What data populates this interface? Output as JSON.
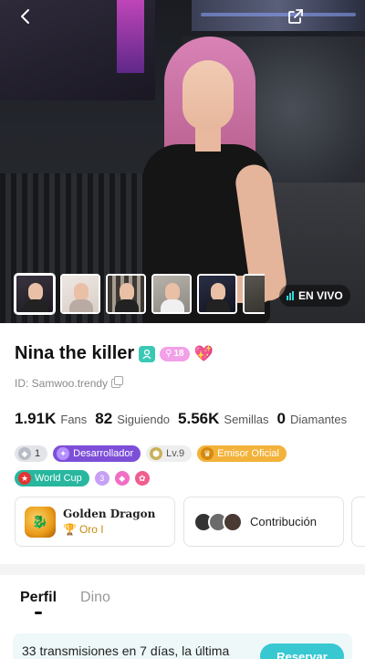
{
  "header": {
    "back_icon": "chevron-left-icon",
    "share_icon": "share-external-icon"
  },
  "thumbnails": [
    "thumb-1",
    "thumb-2",
    "thumb-3",
    "thumb-4",
    "thumb-5",
    "thumb-6"
  ],
  "live": {
    "label": "EN VIVO",
    "color": "#34d6d6"
  },
  "profile": {
    "name": "Nina the killer",
    "level_badge": "18",
    "id_text": "ID: Samwoo.trendy"
  },
  "stats": [
    {
      "value": "1.91K",
      "label": "Fans"
    },
    {
      "value": "82",
      "label": "Siguiendo"
    },
    {
      "value": "5.56K",
      "label": "Semillas"
    },
    {
      "value": "0",
      "label": "Diamantes"
    }
  ],
  "badges": {
    "diamond_count": "1",
    "developer": "Desarrollador",
    "level": "Lv.9",
    "official": "Emisor Oficial",
    "world_cup": "World Cup",
    "mini_level": "3"
  },
  "cards": {
    "dragon_title": "Golden Dragon",
    "dragon_rank": "Oro I",
    "contribution": "Contribución"
  },
  "tabs": [
    {
      "label": "Perfil",
      "active": true
    },
    {
      "label": "Dino",
      "active": false
    }
  ],
  "stream": {
    "text": "33 transmisiones en 7 días, la última",
    "button": "Reservar"
  },
  "colors": {
    "accent": "#38c8d2",
    "name_badge": "#3ac8b5",
    "level_badge": "#f2a0e8",
    "developer_badge": "#7d4fd8",
    "official_badge": "#f3b23a"
  }
}
